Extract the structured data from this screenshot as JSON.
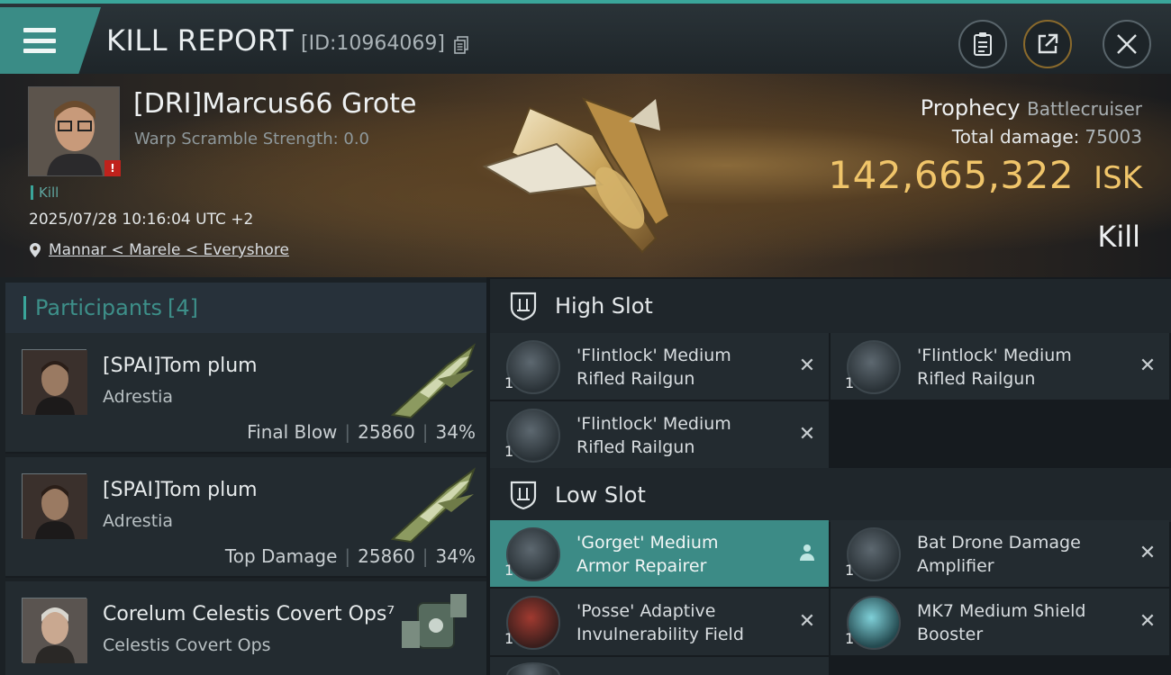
{
  "header": {
    "title": "KILL REPORT",
    "report_id": "[ID:10964069]"
  },
  "victim": {
    "name": "[DRI]Marcus66 Grote",
    "warp_scramble": "Warp Scramble Strength: 0.0",
    "alert_badge": "!",
    "kill_tag": "Kill",
    "timestamp": "2025/07/28 10:16:04 UTC +2",
    "location": "Mannar < Marele < Everyshore"
  },
  "ship": {
    "name": "Prophecy",
    "class": "Battlecruiser",
    "total_damage_label": "Total damage:",
    "total_damage": "75003",
    "isk_value": "142,665,322",
    "isk_unit": "ISK",
    "result": "Kill"
  },
  "participants": {
    "label": "Participants",
    "count": "[4]",
    "rows": [
      {
        "name": "[SPAI]Tom plum",
        "ship": "Adrestia",
        "role": "Final Blow",
        "damage": "25860",
        "percent": "34%"
      },
      {
        "name": "[SPAI]Tom plum",
        "ship": "Adrestia",
        "role": "Top Damage",
        "damage": "25860",
        "percent": "34%"
      },
      {
        "name": "Corelum Celestis Covert Ops⁷",
        "ship": "Celestis Covert Ops",
        "role": "",
        "damage": "",
        "percent": ""
      }
    ]
  },
  "slots": {
    "high": {
      "label": "High Slot",
      "modules": [
        {
          "name_line1": "'Flintlock' Medium",
          "name_line2": "Rifled Railgun",
          "qty": "1",
          "state": "destroyed"
        },
        {
          "name_line1": "'Flintlock' Medium",
          "name_line2": "Rifled Railgun",
          "qty": "1",
          "state": "destroyed"
        },
        {
          "name_line1": "'Flintlock' Medium",
          "name_line2": "Rifled Railgun",
          "qty": "1",
          "state": "destroyed"
        }
      ]
    },
    "low": {
      "label": "Low Slot",
      "modules": [
        {
          "name_line1": "'Gorget' Medium",
          "name_line2": "Armor Repairer",
          "qty": "1",
          "state": "dropped"
        },
        {
          "name_line1": "Bat Drone Damage",
          "name_line2": "Amplifier",
          "qty": "1",
          "state": "destroyed"
        },
        {
          "name_line1": "'Posse' Adaptive",
          "name_line2": "Invulnerability Field",
          "qty": "1",
          "state": "destroyed"
        },
        {
          "name_line1": "MK7 Medium Shield",
          "name_line2": "Booster",
          "qty": "1",
          "state": "destroyed"
        }
      ]
    }
  },
  "colors": {
    "accent": "#3aa59a",
    "isk_gold": "#f0c56a",
    "selected_row": "#3c8b86"
  }
}
